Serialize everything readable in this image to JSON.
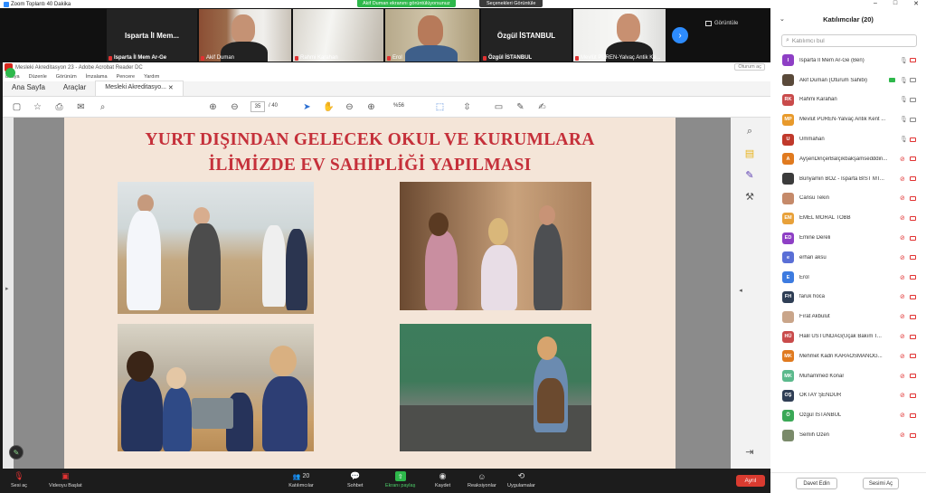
{
  "zoom": {
    "title": "Zoom Toplantı 40 Dakika",
    "share_banner": "Akif Duman ekranını görüntülüyorsunuz",
    "view_options": "Seçenekleri Görüntüle",
    "view_label": "Görüntüle",
    "tiles": [
      {
        "label": "Isparta İl Mem...",
        "name": "Isparta İl Mem Ar-Ge"
      },
      {
        "name": "Akif Duman"
      },
      {
        "name": "Rahmi Karahan"
      },
      {
        "name": "Erol"
      },
      {
        "label": "Özgül İSTANBUL",
        "name": "Özgül İSTANBUL"
      },
      {
        "name": "Mevlüt PÜREN-Yalvaç Antik Ke..."
      }
    ],
    "toolbar": {
      "audio": "Sesi aç",
      "video": "Videoyu Başlat",
      "participants": "Katılımcılar",
      "participants_count": "20",
      "chat": "Sohbet",
      "share": "Ekranı paylaş",
      "record": "Kaydet",
      "reactions": "Reaksiyonlar",
      "apps": "Uygulamalar",
      "leave": "Ayrıl"
    }
  },
  "acrobat": {
    "title": "Mesleki Akreditasyon 23 - Adobe Acrobat Reader DC",
    "sign_in": "Oturum aç",
    "menu": [
      "Dosya",
      "Düzenle",
      "Görünüm",
      "İmzalama",
      "Pencere",
      "Yardım"
    ],
    "tabs": {
      "home": "Ana Sayfa",
      "tools": "Araçlar",
      "doc": "Mesleki Akreditasyo..."
    },
    "page_current": "35",
    "page_total": "/ 40",
    "zoom": "%56"
  },
  "slide": {
    "title_line1": "YURT DIŞINDAN GELECEK OKUL VE KURUMLARA",
    "title_line2": "İLİMİZDE EV SAHİPLİĞİ YAPILMASI"
  },
  "panel": {
    "title": "Katılımcılar (20)",
    "search_placeholder": "Katılımcı bul",
    "invite": "Davet Edin",
    "unmute_me": "Sesimi Aç",
    "participants": [
      {
        "initials": "I",
        "name": "Isparta İl Mem Ar-Ge (Ben)",
        "color": "#8e3fc5",
        "mic_muted": false,
        "cam_on": false
      },
      {
        "initials": "",
        "name": "Akif Duman (Oturum Sahibi)",
        "color": "#5a4a3a",
        "mic_muted": false,
        "cam_on": true,
        "sharing": true
      },
      {
        "initials": "RK",
        "name": "Rahmi Karahan",
        "color": "#c94b4b",
        "mic_muted": false,
        "cam_on": true
      },
      {
        "initials": "MP",
        "name": "Mevlüt PÜREN-Yalvaç Antik Kent ...",
        "color": "#e89a2c",
        "mic_muted": false,
        "cam_on": true
      },
      {
        "initials": "U",
        "name": "Ummahan",
        "color": "#c0392b",
        "mic_muted": false,
        "cam_on": false
      },
      {
        "initials": "A",
        "name": "AyşenDinçerBalçıkbakşamsedddin...",
        "color": "#e07a1f",
        "mic_muted": true,
        "cam_on": false
      },
      {
        "initials": "",
        "name": "Bünyamin BOZ - Isparta BİST MT...",
        "color": "#3b3b3b",
        "mic_muted": true,
        "cam_on": false
      },
      {
        "initials": "",
        "name": "Cansu Tekin",
        "color": "#c58a6a",
        "mic_muted": true,
        "cam_on": false
      },
      {
        "initials": "EM",
        "name": "EMEL MORAL TOBB",
        "color": "#e8a13a",
        "mic_muted": true,
        "cam_on": false
      },
      {
        "initials": "ED",
        "name": "Emine Dereli",
        "color": "#8e3fc5",
        "mic_muted": true,
        "cam_on": false
      },
      {
        "initials": "e",
        "name": "erhan aksu",
        "color": "#5a6fd6",
        "mic_muted": true,
        "cam_on": false
      },
      {
        "initials": "E",
        "name": "Erol",
        "color": "#3d7be0",
        "mic_muted": true,
        "cam_on": false
      },
      {
        "initials": "FH",
        "name": "faruk hoca",
        "color": "#2f3e55",
        "mic_muted": true,
        "cam_on": false
      },
      {
        "initials": "",
        "name": "Fırat Akbulut",
        "color": "#c9a58a",
        "mic_muted": true,
        "cam_on": false
      },
      {
        "initials": "HÜ",
        "name": "Halil ÜSTÜNDAĞ(Uçak Bakım T...",
        "color": "#c94b4b",
        "mic_muted": true,
        "cam_on": false
      },
      {
        "initials": "MK",
        "name": "Mehmet Kadri KARAOSMANOĞ...",
        "color": "#e07a1f",
        "mic_muted": true,
        "cam_on": false
      },
      {
        "initials": "MK",
        "name": "Muhammed Konar",
        "color": "#5bb98c",
        "mic_muted": true,
        "cam_on": false
      },
      {
        "initials": "OŞ",
        "name": "OKTAY ŞENDUR",
        "color": "#2f3e55",
        "mic_muted": true,
        "cam_on": false
      },
      {
        "initials": "Ö",
        "name": "Özgül İSTANBUL",
        "color": "#3aa856",
        "mic_muted": true,
        "cam_on": false
      },
      {
        "initials": "",
        "name": "Semih Özen",
        "color": "#7a8a6a",
        "mic_muted": true,
        "cam_on": false
      }
    ]
  }
}
